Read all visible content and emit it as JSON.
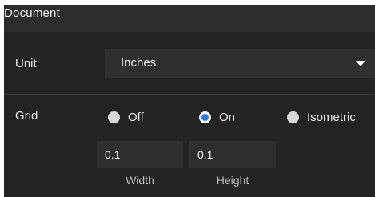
{
  "panel": {
    "title": "Document"
  },
  "unit": {
    "label": "Unit",
    "selected": "Inches"
  },
  "grid": {
    "label": "Grid",
    "options": [
      {
        "label": "Off",
        "checked": false
      },
      {
        "label": "On",
        "checked": true
      },
      {
        "label": "Isometric",
        "checked": false
      }
    ],
    "width": {
      "value": "0.1",
      "label": "Width"
    },
    "height": {
      "value": "0.1",
      "label": "Height"
    }
  },
  "colors": {
    "accent": "#2f7be0",
    "background": "#232323",
    "field": "#2f2f2f"
  },
  "icons": {
    "dropdown": "caret-down-icon"
  }
}
